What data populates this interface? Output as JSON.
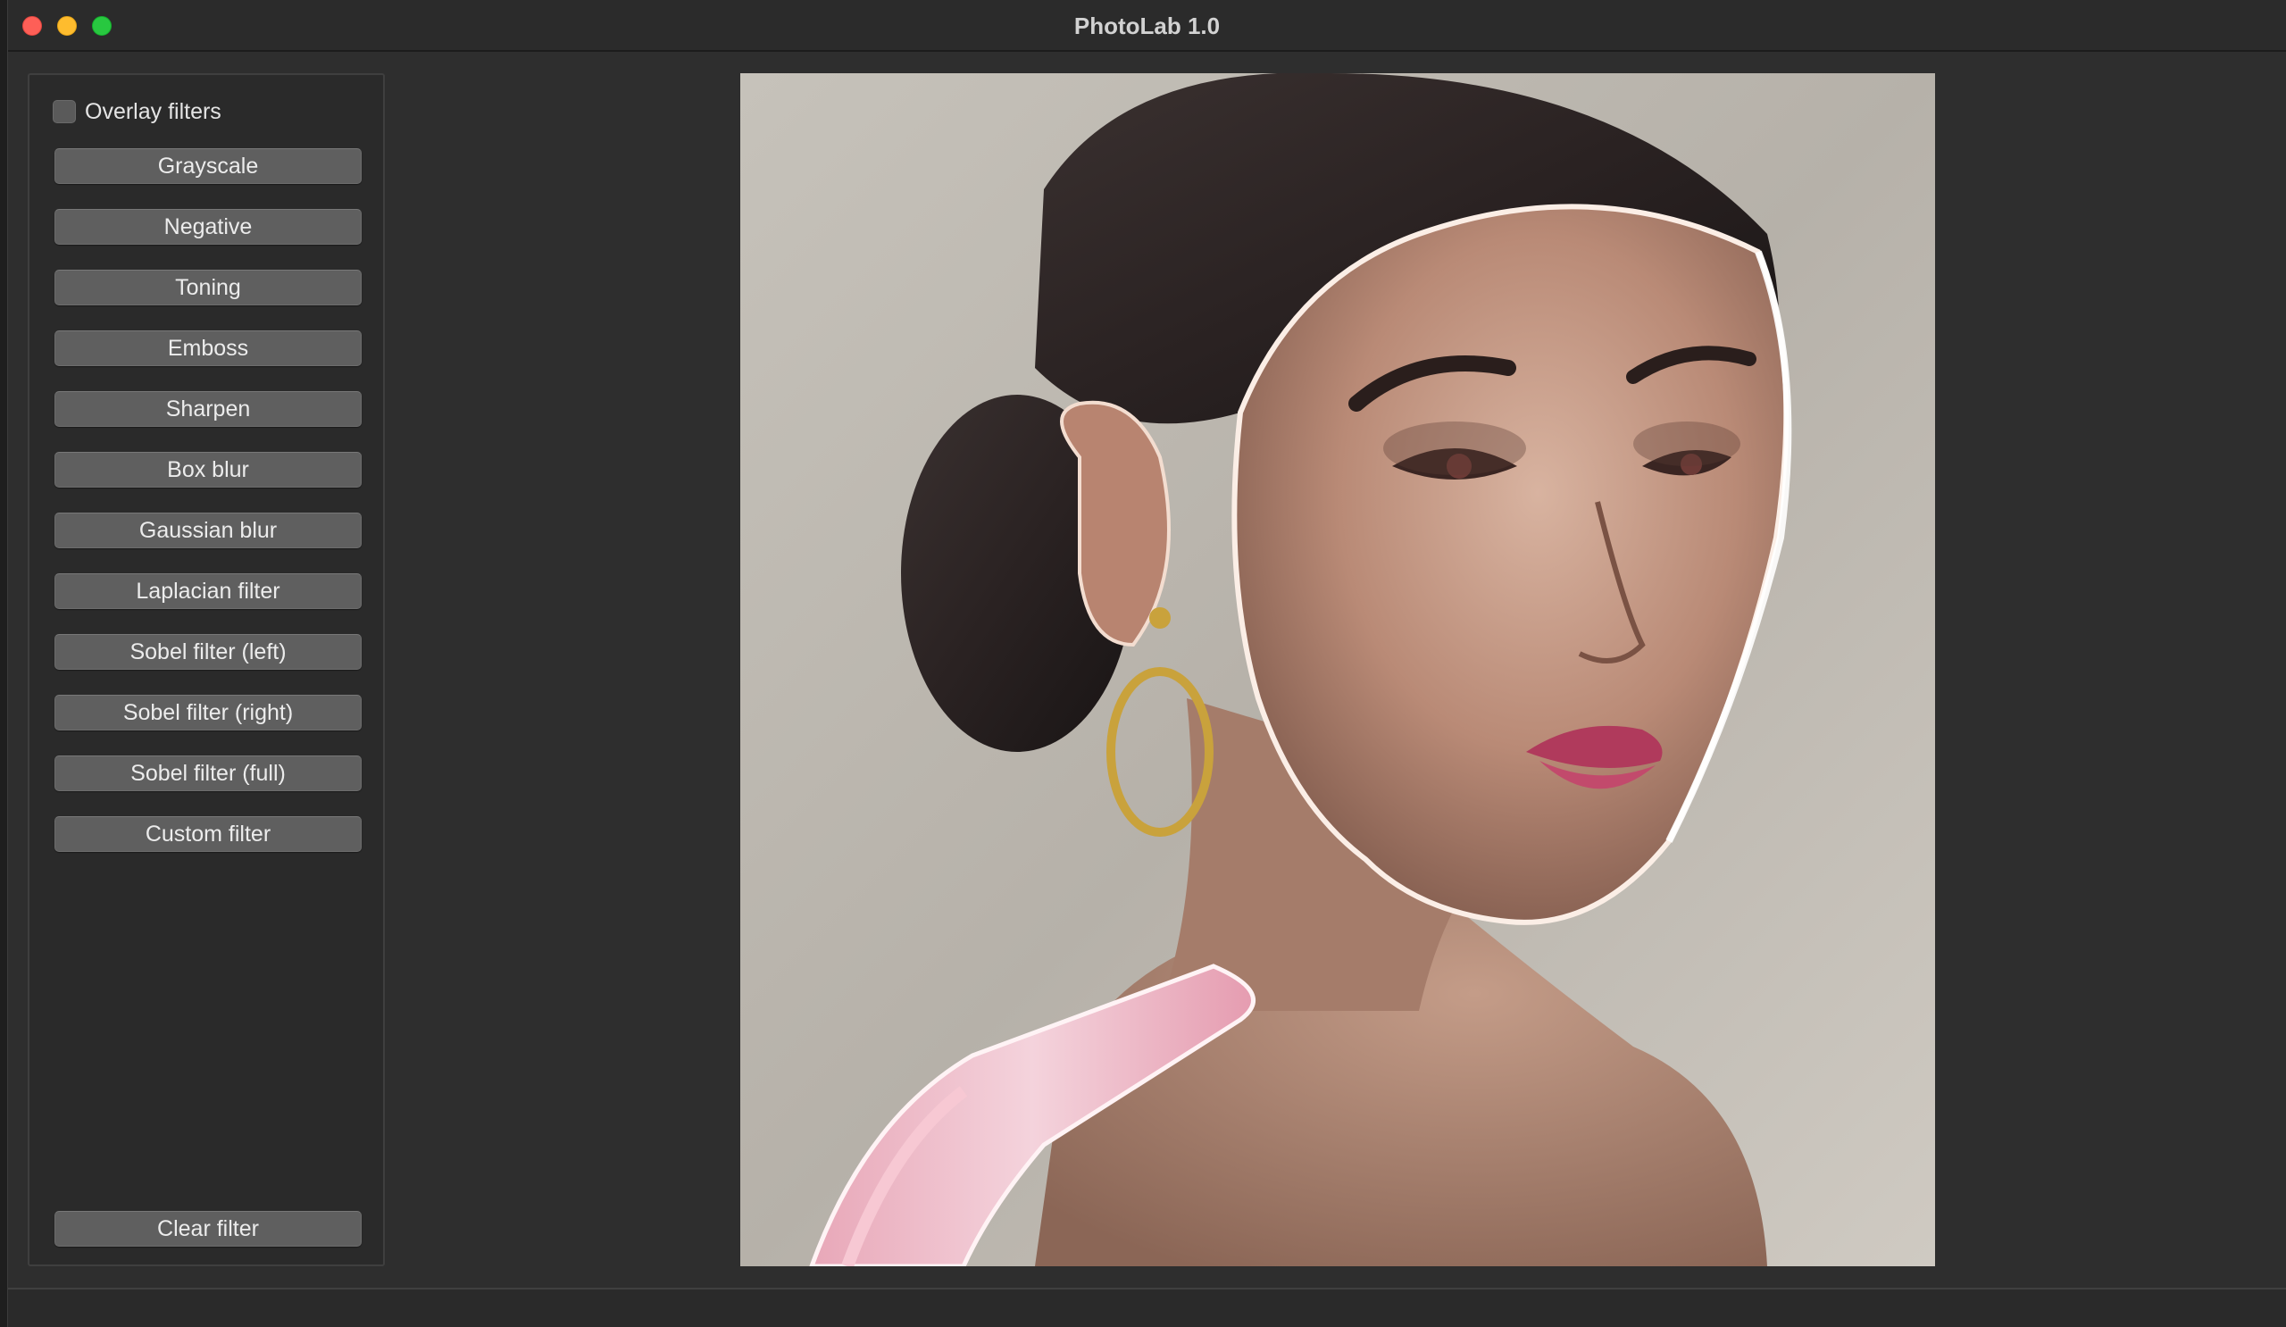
{
  "window": {
    "title": "PhotoLab 1.0"
  },
  "sidebar": {
    "overlay_label": "Overlay filters",
    "overlay_checked": false,
    "buttons": [
      "Grayscale",
      "Negative",
      "Toning",
      "Emboss",
      "Sharpen",
      "Box blur",
      "Gaussian blur",
      "Laplacian filter",
      "Sobel filter (left)",
      "Sobel filter (right)",
      "Sobel filter (full)",
      "Custom filter"
    ],
    "clear_label": "Clear filter"
  },
  "colors": {
    "window_bg": "#2e2e2e",
    "button_bg": "#5f5f5f",
    "close": "#fe5f57",
    "minimize": "#febc2e",
    "maximize": "#28c840"
  },
  "image": {
    "subject": "portrait-photo-filtered"
  }
}
